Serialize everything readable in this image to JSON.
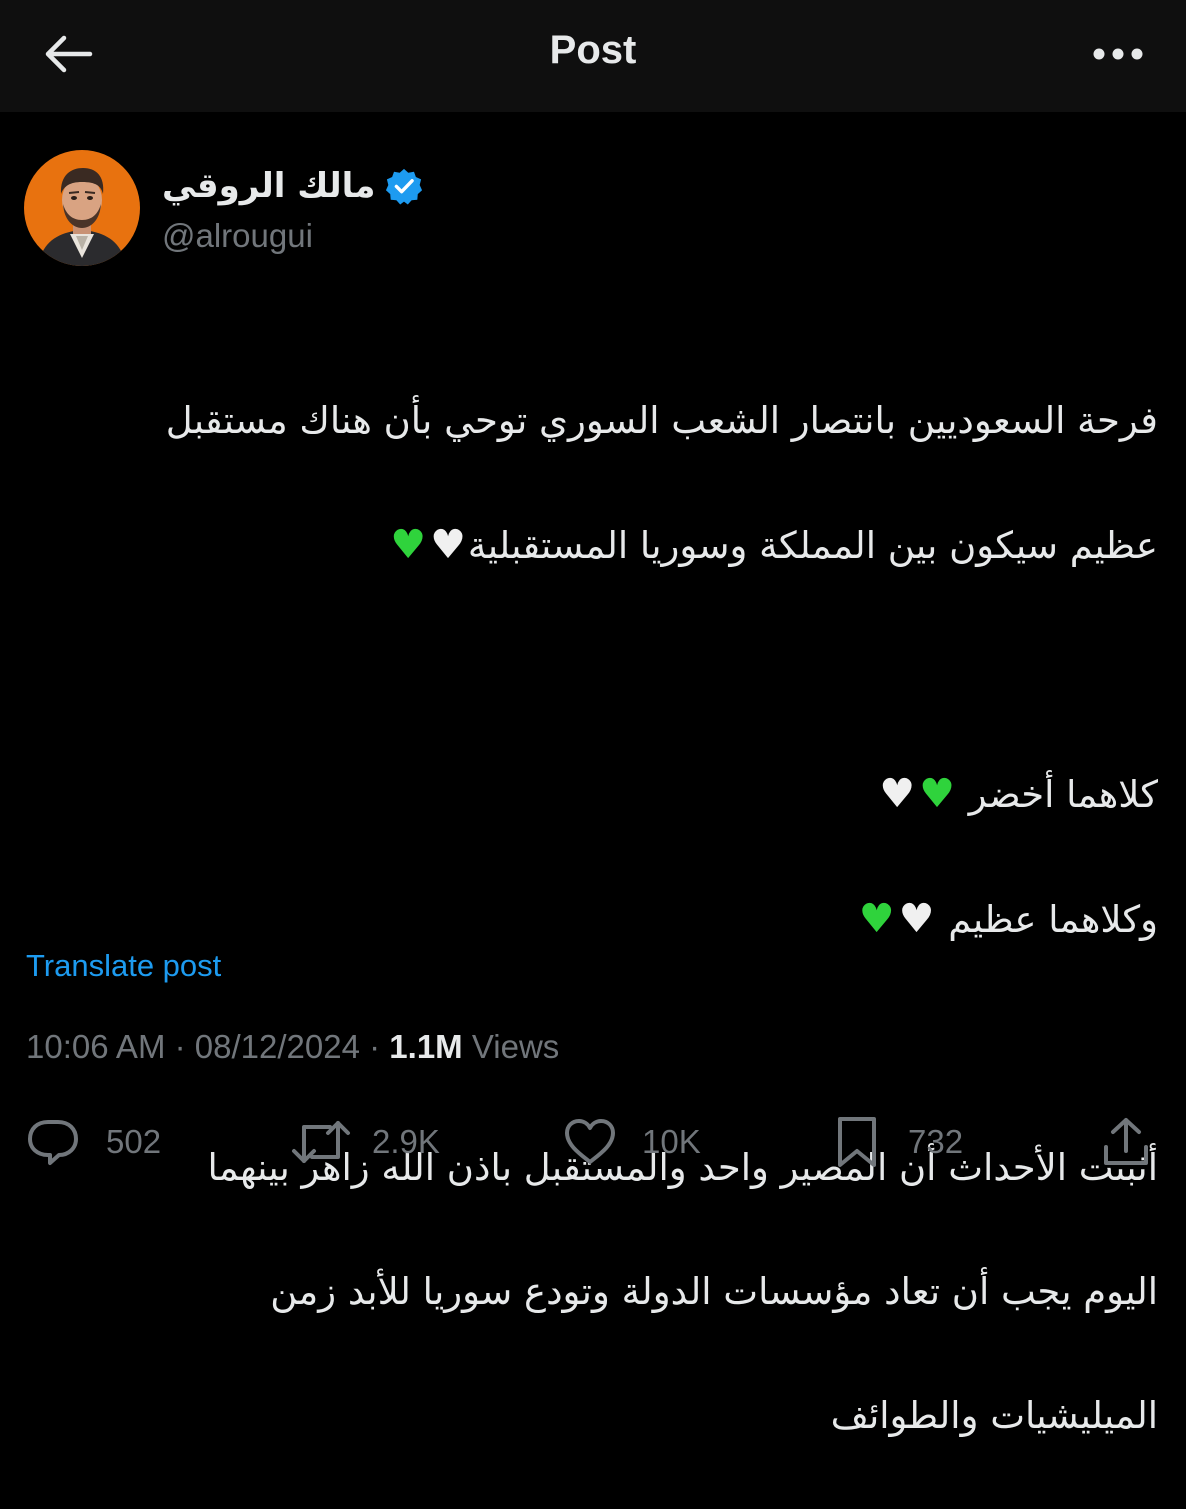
{
  "header": {
    "title": "Post"
  },
  "author": {
    "name": "مالك الروقي",
    "handle": "@alrougui",
    "verified": true
  },
  "tweet": {
    "lines": [
      "فرحة السعوديين بانتصار الشعب السوري توحي بأن هناك مستقبل",
      "عظيم سيكون بين المملكة وسوريا المستقبلية",
      "",
      "كلاهما أخضر",
      "وكلاهما عظيم",
      "",
      "أثبتت الأحداث أن المصير واحد والمستقبل باذن الله زاهر بينهما",
      "اليوم يجب أن تعاد مؤسسات الدولة وتودع سوريا للأبد زمن",
      "الميليشيات والطوائف"
    ]
  },
  "translate_label": "Translate post",
  "meta": {
    "time": "10:06 AM",
    "separator": "·",
    "date": "08/12/2024",
    "views_count": "1.1M",
    "views_label": "Views"
  },
  "actions": {
    "replies": "502",
    "reposts": "2.9K",
    "likes": "10K",
    "bookmarks": "732"
  },
  "colors": {
    "background": "#000000",
    "header_background": "#0f0f0f",
    "text_primary": "#e7e9ea",
    "text_secondary": "#71767b",
    "link": "#1d9bf0",
    "verified_badge": "#1d9bf0",
    "green_heart": "#2fd33c",
    "white_heart": "#f0f0f0"
  },
  "icons": {
    "back": "arrow-left-icon",
    "more": "ellipsis-icon",
    "verified": "verified-badge-icon",
    "reply": "speech-bubble-icon",
    "repost": "repost-arrows-icon",
    "like": "heart-outline-icon",
    "bookmark": "bookmark-icon",
    "share": "share-upload-icon"
  }
}
